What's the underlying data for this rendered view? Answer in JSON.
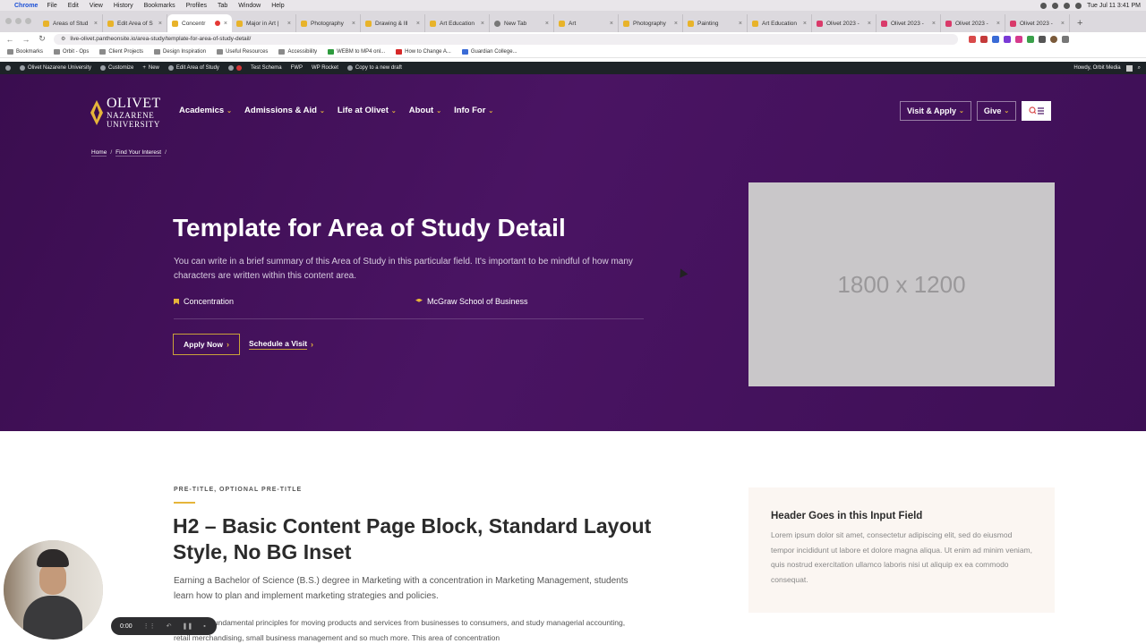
{
  "mac_menu": {
    "app": "Chrome",
    "items": [
      "File",
      "Edit",
      "View",
      "History",
      "Bookmarks",
      "Profiles",
      "Tab",
      "Window",
      "Help"
    ],
    "clock": "Tue Jul 11  3:41 PM"
  },
  "tabs": [
    {
      "title": "Areas of Stud",
      "icon": "olivet-favicon"
    },
    {
      "title": "Edit Area of S",
      "icon": "olivet-favicon"
    },
    {
      "title": "Concentr",
      "icon": "olivet-favicon",
      "active": true
    },
    {
      "title": "Major in Art |",
      "icon": "olivet-favicon"
    },
    {
      "title": "Photography",
      "icon": "olivet-favicon"
    },
    {
      "title": "Drawing & Ill",
      "icon": "olivet-favicon"
    },
    {
      "title": "Art Education",
      "icon": "olivet-favicon"
    },
    {
      "title": "New Tab",
      "icon": "chrome-favicon"
    },
    {
      "title": "Art",
      "icon": "olivet-favicon"
    },
    {
      "title": "Photography",
      "icon": "olivet-favicon"
    },
    {
      "title": "Painting",
      "icon": "olivet-favicon"
    },
    {
      "title": "Art Education",
      "icon": "olivet-favicon"
    },
    {
      "title": "Olivet 2023 -",
      "icon": "design-favicon"
    },
    {
      "title": "Olivet 2023 -",
      "icon": "design-favicon"
    },
    {
      "title": "Olivet 2023 -",
      "icon": "design-favicon"
    },
    {
      "title": "Olivet 2023 -",
      "icon": "design-favicon"
    }
  ],
  "address": {
    "url": "live-olivet.pantheonsite.io/area-study/template-for-area-of-study-detail/"
  },
  "bookmarks": [
    {
      "label": "Bookmarks"
    },
    {
      "label": "Orbit - Ops"
    },
    {
      "label": "Client Projects"
    },
    {
      "label": "Design Inspiration"
    },
    {
      "label": "Useful Resources"
    },
    {
      "label": "Accessibility"
    },
    {
      "label": "WEBM to MP4 onl..."
    },
    {
      "label": "How to Change A..."
    },
    {
      "label": "Guardian College..."
    }
  ],
  "wp_admin": {
    "items": [
      "Olivet Nazarene University",
      "Customize",
      "New",
      "Edit Area of Study",
      "Test Schema",
      "FWP",
      "WP Rocket",
      "Copy to a new draft"
    ],
    "greeting": "Howdy, Orbit Media"
  },
  "site": {
    "logo": {
      "line1": "OLIVET",
      "line2": "NAZARENE",
      "line3": "UNIVERSITY"
    },
    "nav": [
      "Academics",
      "Admissions & Aid",
      "Life at Olivet",
      "About",
      "Info For"
    ],
    "visit_apply": "Visit & Apply",
    "give": "Give",
    "accent": "#e6b53a",
    "brand_purple": "#4a1463"
  },
  "breadcrumb": {
    "home": "Home",
    "interest": "Find Your Interest",
    "separator": "/"
  },
  "hero": {
    "title": "Template for Area of Study Detail",
    "summary": "You can write in a brief summary of this Area of Study in this particular field. It's important to be mindful of how many characters are written within this content area.",
    "type_label": "Concentration",
    "school_label": "McGraw School of Business",
    "apply_label": "Apply Now",
    "visit_label": "Schedule a Visit",
    "image_placeholder": "1800 x 1200"
  },
  "content": {
    "pretitle": "PRE-TITLE, OPTIONAL PRE-TITLE",
    "heading": "H2 – Basic Content Page Block, Standard Layout Style, No BG Inset",
    "para1": "Earning a Bachelor of Science (B.S.) degree in Marketing with a concentration in Marketing Management, students learn how to plan and implement marketing strategies and policies.",
    "para2": "...plore the fundamental principles for moving products and services from businesses to consumers, and study managerial accounting, retail merchandising, small business management and so much more. This area of concentration"
  },
  "sidebar_card": {
    "heading": "Header Goes in this Input Field",
    "body": "Lorem ipsum dolor sit amet, consectetur adipiscing elit, sed do eiusmod tempor incididunt ut labore et dolore magna aliqua. Ut enim ad minim veniam, quis nostrud exercitation ullamco laboris nisi ut aliquip ex ea commodo consequat."
  },
  "recorder": {
    "time": "0:00"
  }
}
